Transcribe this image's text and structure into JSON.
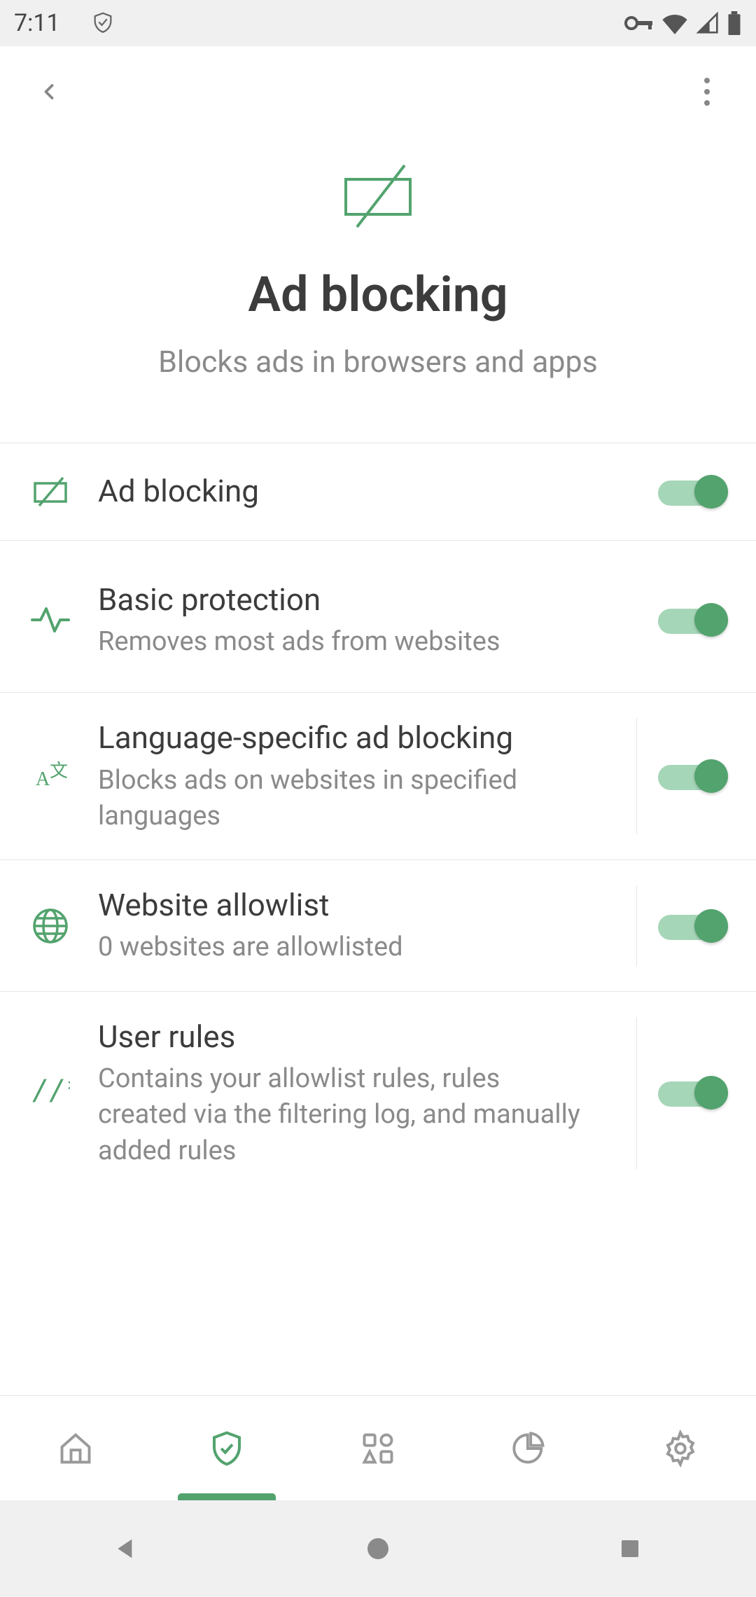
{
  "status": {
    "time": "7:11"
  },
  "header": {
    "title": "Ad blocking",
    "subtitle": "Blocks ads in browsers and apps"
  },
  "rows": [
    {
      "title": "Ad blocking",
      "sub": "",
      "toggle": true
    },
    {
      "title": "Basic protection",
      "sub": "Removes most ads from websites",
      "toggle": true
    },
    {
      "title": "Language-specific ad blocking",
      "sub": "Blocks ads on websites in specified languages",
      "toggle": true
    },
    {
      "title": "Website allowlist",
      "sub": "0 websites are allowlisted",
      "toggle": true
    },
    {
      "title": "User rules",
      "sub": "Contains your allowlist rules, rules created via the filtering log, and manually added rules",
      "toggle": true
    }
  ]
}
